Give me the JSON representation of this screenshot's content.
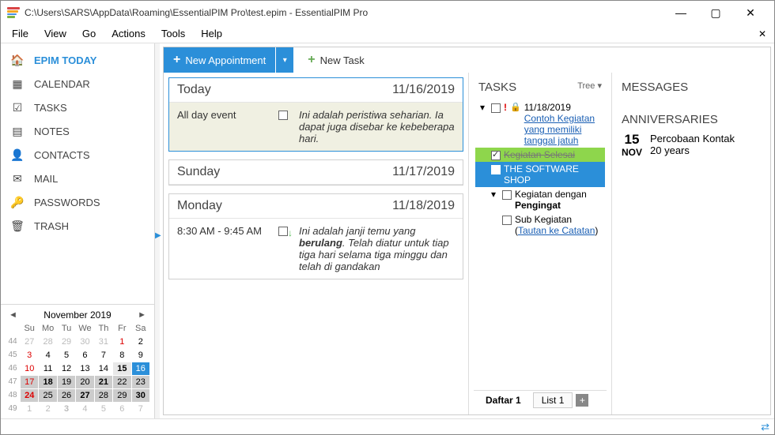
{
  "window": {
    "title": "C:\\Users\\SARS\\AppData\\Roaming\\EssentialPIM Pro\\test.epim - EssentialPIM Pro"
  },
  "menu": [
    "File",
    "View",
    "Go",
    "Actions",
    "Tools",
    "Help"
  ],
  "sidebar": {
    "items": [
      {
        "label": "EPIM TODAY",
        "icon": "home"
      },
      {
        "label": "CALENDAR",
        "icon": "calendar"
      },
      {
        "label": "TASKS",
        "icon": "tasks"
      },
      {
        "label": "NOTES",
        "icon": "notes"
      },
      {
        "label": "CONTACTS",
        "icon": "contacts"
      },
      {
        "label": "MAIL",
        "icon": "mail"
      },
      {
        "label": "PASSWORDS",
        "icon": "passwords"
      },
      {
        "label": "TRASH",
        "icon": "trash"
      }
    ]
  },
  "toolbar": {
    "new_appt": "New Appointment",
    "new_task": "New Task"
  },
  "calendar_mini": {
    "title": "November  2019",
    "dow": [
      "Su",
      "Mo",
      "Tu",
      "We",
      "Th",
      "Fr",
      "Sa"
    ],
    "weeks": [
      {
        "wk": "44",
        "days": [
          {
            "n": "27",
            "cls": "grey"
          },
          {
            "n": "28",
            "cls": "grey"
          },
          {
            "n": "29",
            "cls": "grey"
          },
          {
            "n": "30",
            "cls": "grey"
          },
          {
            "n": "31",
            "cls": "grey"
          },
          {
            "n": "1",
            "cls": "red"
          },
          {
            "n": "2",
            "cls": ""
          }
        ]
      },
      {
        "wk": "45",
        "days": [
          {
            "n": "3",
            "cls": "red"
          },
          {
            "n": "4",
            "cls": ""
          },
          {
            "n": "5",
            "cls": ""
          },
          {
            "n": "6",
            "cls": ""
          },
          {
            "n": "7",
            "cls": ""
          },
          {
            "n": "8",
            "cls": ""
          },
          {
            "n": "9",
            "cls": ""
          }
        ]
      },
      {
        "wk": "46",
        "days": [
          {
            "n": "10",
            "cls": "red"
          },
          {
            "n": "11",
            "cls": ""
          },
          {
            "n": "12",
            "cls": ""
          },
          {
            "n": "13",
            "cls": ""
          },
          {
            "n": "14",
            "cls": ""
          },
          {
            "n": "15",
            "cls": "bold greybg"
          },
          {
            "n": "16",
            "cls": "sel"
          }
        ]
      },
      {
        "wk": "47",
        "days": [
          {
            "n": "17",
            "cls": "red hl"
          },
          {
            "n": "18",
            "cls": "bold hl"
          },
          {
            "n": "19",
            "cls": "hl"
          },
          {
            "n": "20",
            "cls": "hl"
          },
          {
            "n": "21",
            "cls": "bold hl"
          },
          {
            "n": "22",
            "cls": "hl"
          },
          {
            "n": "23",
            "cls": "hl"
          }
        ]
      },
      {
        "wk": "48",
        "days": [
          {
            "n": "24",
            "cls": "red bold hl"
          },
          {
            "n": "25",
            "cls": "hl"
          },
          {
            "n": "26",
            "cls": "hl"
          },
          {
            "n": "27",
            "cls": "bold hl"
          },
          {
            "n": "28",
            "cls": "hl"
          },
          {
            "n": "29",
            "cls": "hl"
          },
          {
            "n": "30",
            "cls": "bold hl"
          }
        ]
      },
      {
        "wk": "49",
        "days": [
          {
            "n": "1",
            "cls": "grey"
          },
          {
            "n": "2",
            "cls": "grey"
          },
          {
            "n": "3",
            "cls": "grey bold"
          },
          {
            "n": "4",
            "cls": "grey"
          },
          {
            "n": "5",
            "cls": "grey"
          },
          {
            "n": "6",
            "cls": "grey"
          },
          {
            "n": "7",
            "cls": "grey"
          }
        ]
      }
    ]
  },
  "days": [
    {
      "title": "Today",
      "date": "11/16/2019",
      "events": [
        {
          "time": "All day event",
          "desc": "Ini adalah peristiwa seharian. Ia dapat juga disebar ke kebeberapa hari.",
          "allday": true
        }
      ],
      "current": true
    },
    {
      "title": "Sunday",
      "date": "11/17/2019",
      "events": [],
      "current": false
    },
    {
      "title": "Monday",
      "date": "11/18/2019",
      "events": [
        {
          "time": "8:30 AM - 9:45 AM",
          "desc_pre": "Ini adalah janji temu yang ",
          "desc_bold": "berulang",
          "desc_post": ". Telah diatur untuk tiap tiga hari selama tiga minggu dan telah di gandakan",
          "allday": false,
          "recur": true
        }
      ],
      "current": false
    }
  ],
  "tasks": {
    "header": "TASKS",
    "view_label": "Tree",
    "tabs": [
      "Daftar 1",
      "List 1"
    ],
    "items": {
      "t1_date": "11/18/2019",
      "t1_text": "Contoh Kegiatan yang memiliki tanggal jatuh",
      "t2_text": "Kegiatan Selesai",
      "t3_text": "THE SOFTWARE SHOP",
      "t4_text_pre": "Kegiatan dengan ",
      "t4_text_bold": "Pengingat",
      "t5_text_pre": "Sub Kegiatan (",
      "t5_link": "Tautan ke Catatan",
      "t5_text_post": ")"
    }
  },
  "messages": {
    "header": "MESSAGES"
  },
  "anniversaries": {
    "header": "ANNIVERSARIES",
    "day": "15",
    "month": "NOV",
    "name": "Percobaan Kontak",
    "age": "20 years"
  }
}
